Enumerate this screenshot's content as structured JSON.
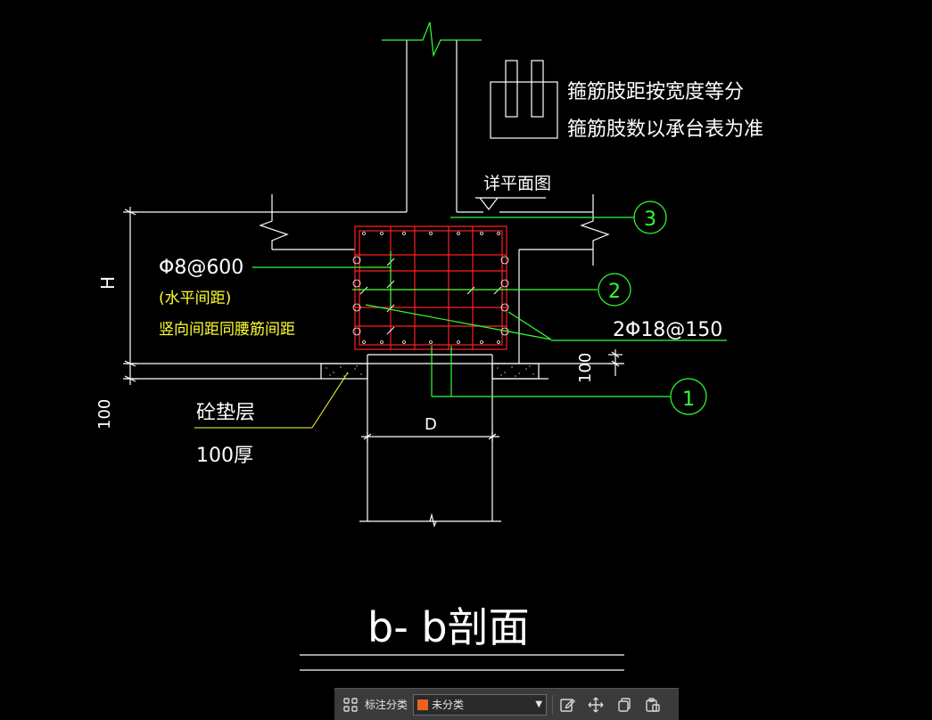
{
  "drawing": {
    "note_line1": "箍筋肢距按宽度等分",
    "note_line2": "箍筋肢数以承台表为准",
    "detail_ref": "详平面图",
    "stirrup_spec": "Φ8@600",
    "stirrup_note1": "(水平间距)",
    "stirrup_note2": "竖向间距同腰筋间距",
    "bar_spec": "2Φ18@150",
    "height_label": "H",
    "dim_100_right": "100",
    "dim_100_left": "100",
    "pad_label1": "砼垫层",
    "pad_label2": "100厚",
    "width_label": "D",
    "callout_1": "1",
    "callout_2": "2",
    "callout_3": "3",
    "section_title": "b- b剖面"
  },
  "toolbar": {
    "category_label": "标注分类",
    "category_value": "未分类",
    "swatch_color": "#e8641e"
  },
  "colors": {
    "line_white": "#ffffff",
    "rebar_red": "#ff2020",
    "leader_green": "#33ff33",
    "text_yellow": "#ffff33"
  }
}
